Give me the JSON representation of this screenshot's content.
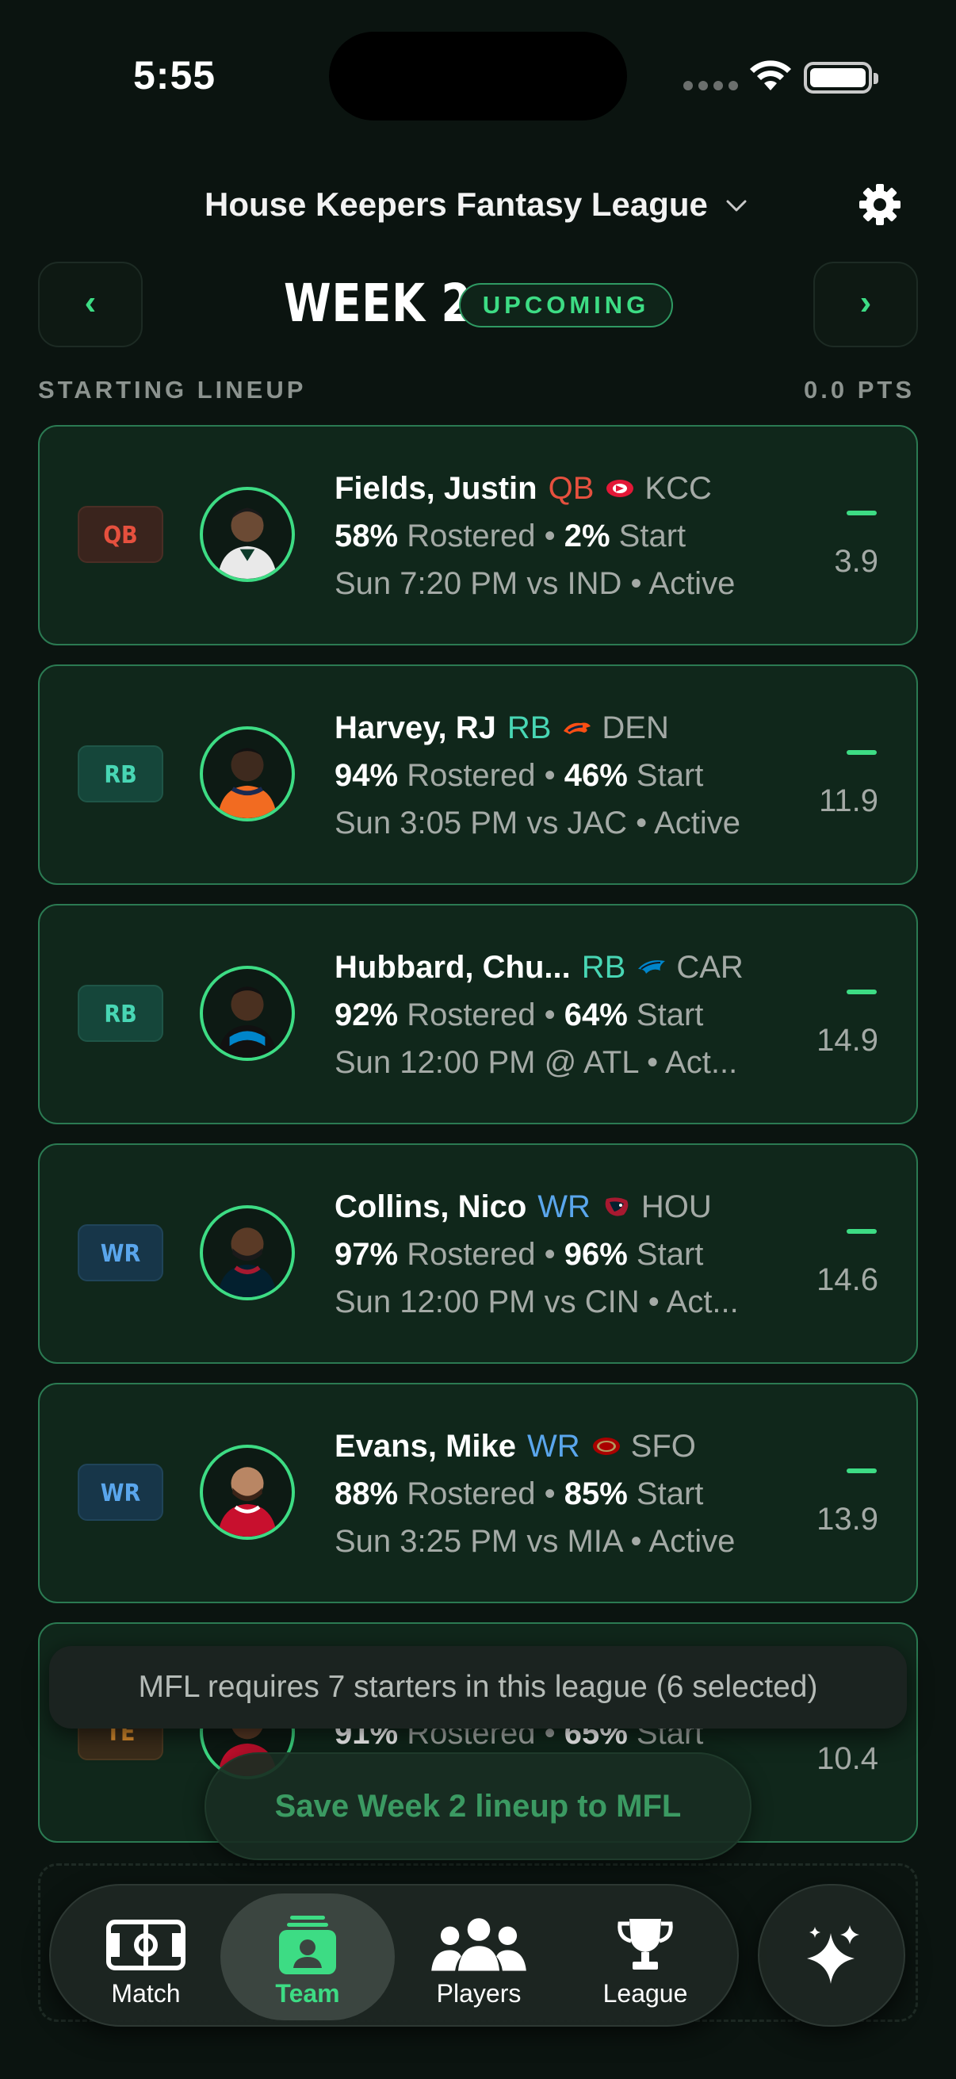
{
  "status_bar": {
    "time": "5:55"
  },
  "header": {
    "league_name": "House Keepers Fantasy League"
  },
  "week": {
    "prev": "‹",
    "next": "›",
    "title": "WEEK 2",
    "status": "UPCOMING"
  },
  "section": {
    "label": "STARTING LINEUP",
    "points": "0.0 PTS"
  },
  "players": [
    {
      "slot": "QB",
      "name": "Fields, Justin",
      "position": "QB",
      "team": "KCC",
      "rostered_pct": "58%",
      "rostered_label": "Rostered",
      "start_pct": "2%",
      "start_label": "Start",
      "game": "Sun 7:20 PM vs IND • Active",
      "score": "–",
      "projection": "3.9"
    },
    {
      "slot": "RB",
      "name": "Harvey, RJ",
      "position": "RB",
      "team": "DEN",
      "rostered_pct": "94%",
      "rostered_label": "Rostered",
      "start_pct": "46%",
      "start_label": "Start",
      "game": "Sun 3:05 PM vs JAC • Active",
      "score": "–",
      "projection": "11.9"
    },
    {
      "slot": "RB",
      "name": "Hubbard, Chu...",
      "position": "RB",
      "team": "CAR",
      "rostered_pct": "92%",
      "rostered_label": "Rostered",
      "start_pct": "64%",
      "start_label": "Start",
      "game": "Sun 12:00 PM @ ATL • Act...",
      "score": "–",
      "projection": "14.9"
    },
    {
      "slot": "WR",
      "name": "Collins, Nico",
      "position": "WR",
      "team": "HOU",
      "rostered_pct": "97%",
      "rostered_label": "Rostered",
      "start_pct": "96%",
      "start_label": "Start",
      "game": "Sun 12:00 PM vs CIN • Act...",
      "score": "–",
      "projection": "14.6"
    },
    {
      "slot": "WR",
      "name": "Evans, Mike",
      "position": "WR",
      "team": "SFO",
      "rostered_pct": "88%",
      "rostered_label": "Rostered",
      "start_pct": "85%",
      "start_label": "Start",
      "game": "Sun 3:25 PM vs MIA • Active",
      "score": "–",
      "projection": "13.9"
    },
    {
      "slot": "TE",
      "rostered_pct": "91%",
      "rostered_label": "Rostered",
      "start_pct": "65%",
      "start_label": "Start",
      "projection": "10.4"
    }
  ],
  "toast": {
    "message": "MFL requires 7 starters in this league (6 selected)"
  },
  "save_button": {
    "label": "Save Week 2 lineup to MFL"
  },
  "tabs": [
    {
      "label": "Match",
      "icon": "field-icon"
    },
    {
      "label": "Team",
      "icon": "roster-icon",
      "active": true
    },
    {
      "label": "Players",
      "icon": "people-icon"
    },
    {
      "label": "League",
      "icon": "trophy-icon"
    }
  ],
  "colors": {
    "accent": "#3ddc84",
    "qb": "#e5503e",
    "rb": "#48d6b4",
    "wr": "#5aa6ec",
    "te": "#e2922f",
    "background": "#0b1410",
    "card": "#10271b"
  }
}
